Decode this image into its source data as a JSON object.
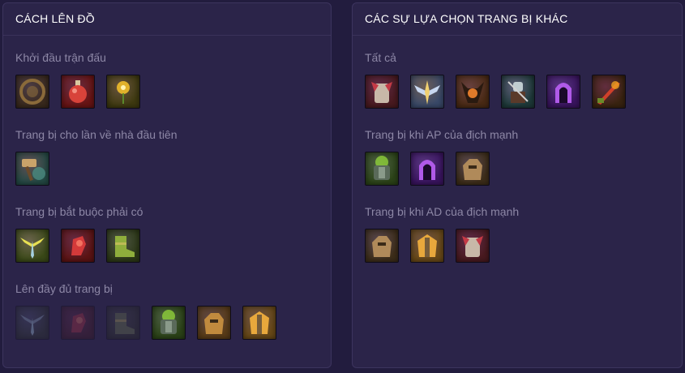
{
  "build": {
    "title": "CÁCH LÊN ĐỒ",
    "sections": [
      {
        "label": "Khởi đầu trận đấu",
        "items": [
          {
            "icon": "round-shield-icon",
            "bg": "#3a2a1e",
            "fg": "#8a6a3a",
            "dim": false
          },
          {
            "icon": "red-potion-icon",
            "bg": "#6a1414",
            "fg": "#d8433a",
            "dim": false
          },
          {
            "icon": "golden-flower-icon",
            "bg": "#3f3a10",
            "fg": "#e0b12b",
            "dim": false
          }
        ]
      },
      {
        "label": "Trang bị cho lần về nhà đầu tiên",
        "items": [
          {
            "icon": "hammer-shield-icon",
            "bg": "#244a45",
            "fg": "#c9a36a",
            "dim": false
          }
        ]
      },
      {
        "label": "Trang bị bắt buộc phải có",
        "items": [
          {
            "icon": "winged-sword-icon",
            "bg": "#3b4a18",
            "fg": "#e8e052",
            "dim": false
          },
          {
            "icon": "red-gauntlet-icon",
            "bg": "#5e1414",
            "fg": "#d43a3a",
            "dim": false
          },
          {
            "icon": "green-boots-icon",
            "bg": "#2e3a18",
            "fg": "#8fae3c",
            "dim": false
          }
        ]
      },
      {
        "label": "Lên đầy đủ trang bị",
        "items": [
          {
            "icon": "winged-sword-icon",
            "bg": "#2f3a2a",
            "fg": "#8aa6b8",
            "dim": true
          },
          {
            "icon": "red-gauntlet-icon",
            "bg": "#4a1a22",
            "fg": "#b0303e",
            "dim": true
          },
          {
            "icon": "green-boots-icon",
            "bg": "#2e3424",
            "fg": "#6a7a4a",
            "dim": true
          },
          {
            "icon": "green-armor-icon",
            "bg": "#2c4418",
            "fg": "#8ed03a",
            "dim": false
          },
          {
            "icon": "stone-golem-icon",
            "bg": "#5a3c18",
            "fg": "#c08a3e",
            "dim": false
          },
          {
            "icon": "golden-plate-icon",
            "bg": "#6a4a18",
            "fg": "#e8a83c",
            "dim": false
          }
        ]
      }
    ]
  },
  "alternatives": {
    "title": "CÁC SỰ LỰA CHỌN TRANG BỊ KHÁC",
    "sections": [
      {
        "label": "Tất cả",
        "items": [
          {
            "icon": "crimson-armor-icon",
            "bg": "#4a1a20",
            "fg": "#c43a46",
            "dim": false
          },
          {
            "icon": "winged-blade-icon",
            "bg": "#3a4a6a",
            "fg": "#f0d070",
            "dim": false
          },
          {
            "icon": "horned-helm-icon",
            "bg": "#4a2a14",
            "fg": "#e07a2a",
            "dim": false
          },
          {
            "icon": "teal-warrior-icon",
            "bg": "#1e3a3a",
            "fg": "#c0ccd0",
            "dim": false
          },
          {
            "icon": "purple-hood-icon",
            "bg": "#3a1460",
            "fg": "#b05ae8",
            "dim": false
          },
          {
            "icon": "fire-blade-icon",
            "bg": "#3a2410",
            "fg": "#d0402a",
            "dim": false
          }
        ]
      },
      {
        "label": "Trang bị khi AP của địch mạnh",
        "items": [
          {
            "icon": "green-armor-icon",
            "bg": "#2c4418",
            "fg": "#8ed03a",
            "dim": false
          },
          {
            "icon": "purple-hood-icon",
            "bg": "#3a1460",
            "fg": "#b05ae8",
            "dim": false
          },
          {
            "icon": "stone-golem-icon",
            "bg": "#3e2e1a",
            "fg": "#b08a5a",
            "dim": false
          }
        ]
      },
      {
        "label": "Trang bị khi AD của địch mạnh",
        "items": [
          {
            "icon": "stone-golem-icon",
            "bg": "#3e2e1a",
            "fg": "#b08a5a",
            "dim": false
          },
          {
            "icon": "golden-plate-icon",
            "bg": "#6a4a18",
            "fg": "#e8a83c",
            "dim": false
          },
          {
            "icon": "crimson-armor-icon",
            "bg": "#4a1a20",
            "fg": "#c43a46",
            "dim": false
          }
        ]
      }
    ]
  }
}
